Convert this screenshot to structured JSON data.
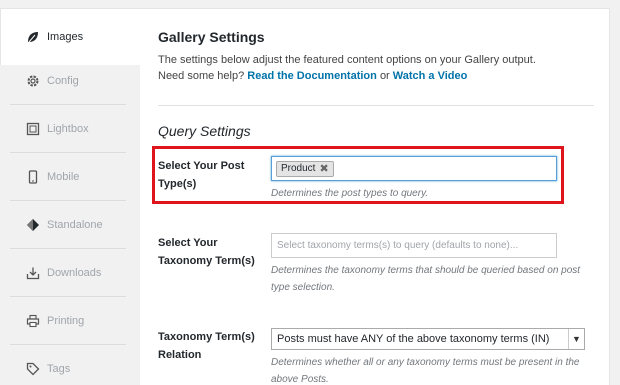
{
  "sidebar": {
    "items": [
      {
        "label": "Images",
        "icon": "leaf-icon"
      },
      {
        "label": "Config",
        "icon": "gear-icon"
      },
      {
        "label": "Lightbox",
        "icon": "lightbox-icon"
      },
      {
        "label": "Mobile",
        "icon": "mobile-icon"
      },
      {
        "label": "Standalone",
        "icon": "diamond-icon"
      },
      {
        "label": "Downloads",
        "icon": "download-icon"
      },
      {
        "label": "Printing",
        "icon": "printer-icon"
      },
      {
        "label": "Tags",
        "icon": "tag-icon"
      }
    ],
    "active_index": 0
  },
  "main": {
    "title": "Gallery Settings",
    "description": "The settings below adjust the featured content options on your Gallery output.",
    "help_prefix": "Need some help?",
    "doc_link": "Read the Documentation",
    "or_text": "or",
    "video_link": "Watch a Video",
    "section_title": "Query Settings"
  },
  "fields": {
    "post_type": {
      "label": "Select Your Post Type(s)",
      "tag": "Product",
      "help": "Determines the post types to query."
    },
    "taxonomy": {
      "label": "Select Your Taxonomy Term(s)",
      "placeholder": "Select taxonomy terms(s) to query (defaults to none)...",
      "help": "Determines the taxonomy terms that should be queried based on post type selection."
    },
    "relation": {
      "label": "Taxonomy Term(s) Relation",
      "selected": "Posts must have ANY of the above taxonomy terms (IN)",
      "help": "Determines whether all or any taxonomy terms must be present in the above Posts."
    }
  },
  "colors": {
    "accent": "#0073aa",
    "highlight": "#e0151b"
  }
}
